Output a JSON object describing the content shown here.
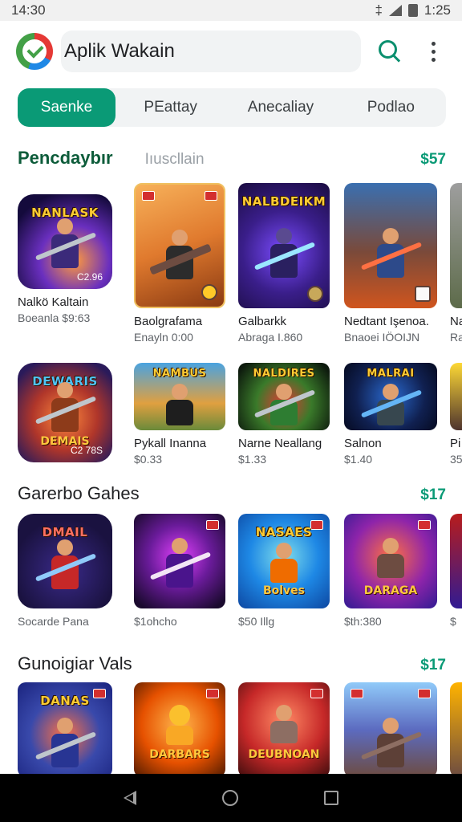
{
  "status_bar": {
    "time": "14:30",
    "right_text": "1:25",
    "icons": [
      "bluetooth-icon",
      "wifi-icon",
      "signal-icon",
      "battery-icon"
    ]
  },
  "header": {
    "logo": "app-logo",
    "search_text": "Aplik Wakain",
    "search_icon": "search-icon",
    "more_icon": "more-vert-icon"
  },
  "tabs": [
    {
      "label": "Saenke",
      "active": true
    },
    {
      "label": "PEattay",
      "active": false
    },
    {
      "label": "Anecaliay",
      "active": false
    },
    {
      "label": "Podlao",
      "active": false
    }
  ],
  "section1": {
    "title": "Pencdaybır",
    "subtitle": "Iıuscllain",
    "more": "$57",
    "row1": [
      {
        "name": "Nalkö Kaltain",
        "meta": "Boeanla $9:63",
        "tile_title": "NANLASK",
        "tile_price": "C2.96"
      },
      {
        "name": "Baolgrafama",
        "meta": "Enayln 0:00",
        "tile_title": ""
      },
      {
        "name": "Galbarkk",
        "meta": "Abraga I.860",
        "tile_title": "NALBDEIKM"
      },
      {
        "name": "Nedtant Işenoa.",
        "meta": "Bnaoei IÖOIJN",
        "tile_title": ""
      },
      {
        "name": "Na",
        "meta": "Ra",
        "tile_title": ""
      }
    ],
    "row2": [
      {
        "name": "",
        "meta": "",
        "tile_title": "DEWARIS",
        "tile_bottom": "DEMAIS",
        "tile_price": "C2 78S"
      },
      {
        "name": "Pykall Inanna",
        "meta": "$0.33",
        "tile_title": "NAMBUS"
      },
      {
        "name": "Narne Neallang",
        "meta": "$1.33",
        "tile_title": "NALDIRES"
      },
      {
        "name": "Salnon",
        "meta": "$1.40",
        "tile_title": "MALRAI"
      },
      {
        "name": "Pi",
        "meta": "35",
        "tile_title": ""
      }
    ]
  },
  "section2": {
    "title": "Garerbo Gahes",
    "more": "$17",
    "row": [
      {
        "name": "Socarde Pana",
        "meta": "",
        "tile_title": "DMAIL"
      },
      {
        "name": "$1ohcho",
        "meta": "",
        "tile_title": ""
      },
      {
        "name": "$50 Illg",
        "meta": "",
        "tile_title": "NASAES",
        "tile_bottom": "Bolves"
      },
      {
        "name": "$th:380",
        "meta": "",
        "tile_title": "",
        "tile_bottom": "DARAGA"
      },
      {
        "name": "$",
        "meta": "",
        "tile_title": ""
      }
    ]
  },
  "section3": {
    "title": "Gunoigiar Vals",
    "more": "$17",
    "row": [
      {
        "tile_title": "DANAS"
      },
      {
        "tile_title": "",
        "tile_bottom": "DARBARS"
      },
      {
        "tile_title": "",
        "tile_bottom": "DEUBNOAN"
      },
      {
        "tile_title": ""
      },
      {
        "tile_title": ""
      }
    ]
  },
  "nav": {
    "back_icon": "back-icon",
    "home_icon": "home-icon",
    "recent_icon": "recent-apps-icon"
  },
  "colors": {
    "accent": "#0a9a76",
    "title_green": "#0d5c3a",
    "nav_bg": "#000000"
  }
}
